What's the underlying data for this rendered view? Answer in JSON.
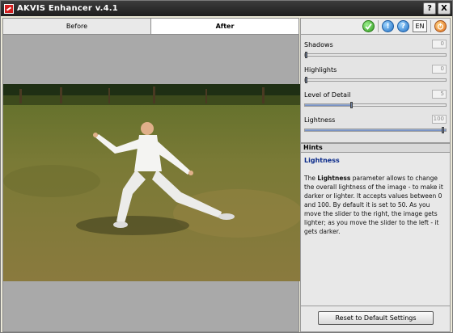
{
  "window": {
    "title": "AKVIS Enhancer v.4.1",
    "help_btn": "?",
    "close_btn": "X"
  },
  "tabs": [
    {
      "label": "Before",
      "active": false
    },
    {
      "label": "After",
      "active": true
    }
  ],
  "toolbar": {
    "lang_label": "EN",
    "icons": [
      "apply-icon",
      "info-icon",
      "help-icon",
      "power-icon"
    ],
    "info_glyph": "!",
    "help_glyph": "?"
  },
  "params": {
    "shadows": {
      "label": "Shadows",
      "value": "0",
      "level": 0
    },
    "highlights": {
      "label": "Highlights",
      "value": "0",
      "level": 0
    },
    "level_of_detail": {
      "label": "Level of Detail",
      "value": "5",
      "level": 0.33
    },
    "lightness": {
      "label": "Lightness",
      "value": "100",
      "level": 1.0
    }
  },
  "hints": {
    "header": "Hints",
    "title": "Lightness",
    "text_pre": "The ",
    "text_bold": "Lightness",
    "text_post": " parameter allows to change the overall lightness of the image - to make it darker or lighter. It accepts values between 0 and 100. By default it is set to 50. As you move the slider to the right, the image gets lighter; as you move the slider to the left - it gets darker."
  },
  "reset_label": "Reset to Default Settings",
  "colors": {
    "accent_fill": "#6c87bd",
    "hint_title": "#0a2a8a",
    "titlebar": "#2a2a2a"
  }
}
